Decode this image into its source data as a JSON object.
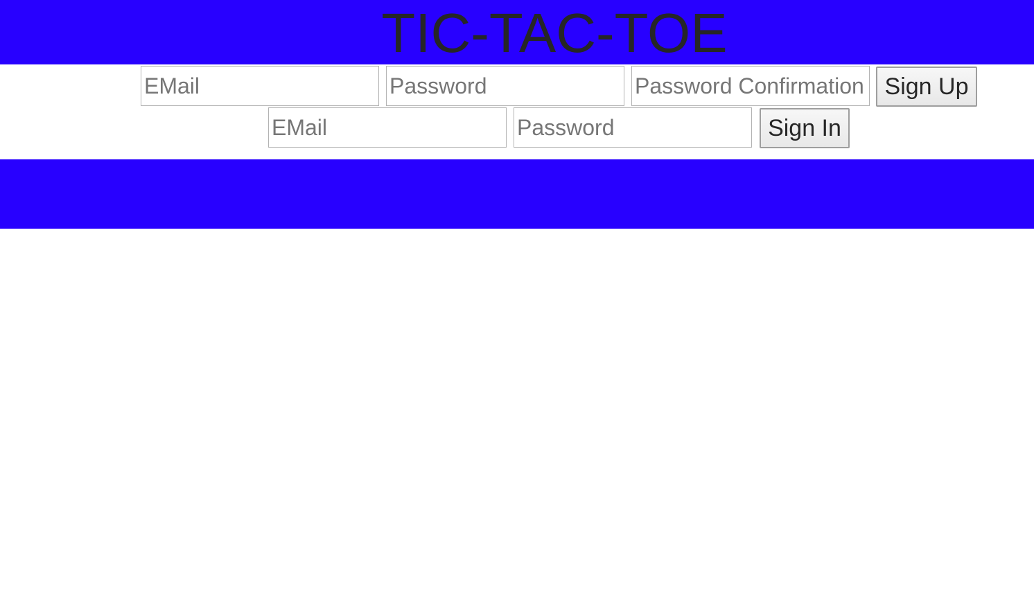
{
  "header": {
    "title": "TIC-TAC-TOE"
  },
  "sign_up": {
    "email_placeholder": "EMail",
    "password_placeholder": "Password",
    "password_confirmation_placeholder": "Password Confirmation",
    "button_label": "Sign Up"
  },
  "sign_in": {
    "email_placeholder": "EMail",
    "password_placeholder": "Password",
    "button_label": "Sign In"
  },
  "colors": {
    "banner": "#2800ff",
    "title_text": "#262626",
    "background": "#ffffff"
  }
}
